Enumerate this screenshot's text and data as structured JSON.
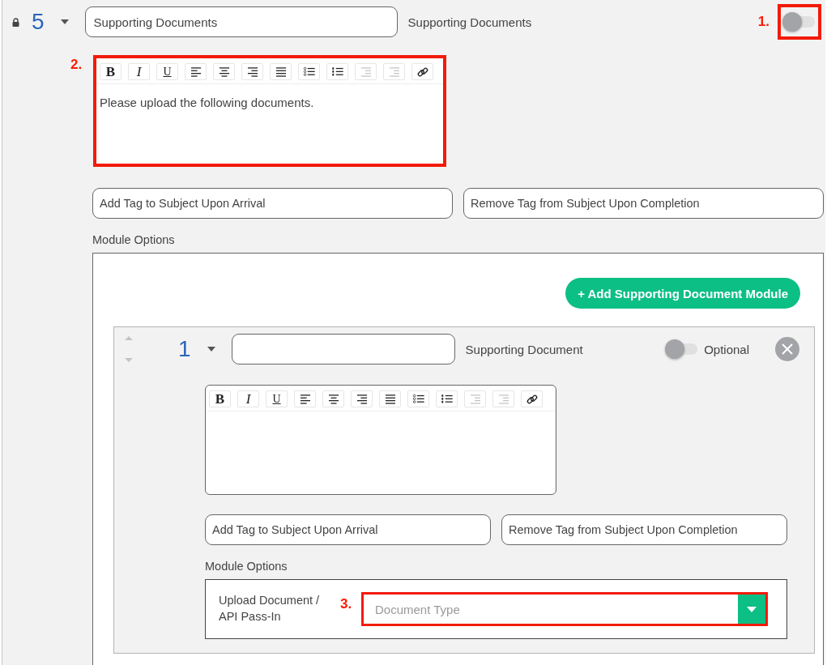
{
  "section": {
    "number": "5",
    "title_value": "Supporting Documents",
    "type_label": "Supporting Documents",
    "enabled": false,
    "toggle_callout": "1.",
    "editor": {
      "callout": "2.",
      "content": "Please upload the following documents.",
      "toolbar": [
        {
          "kind": "bold",
          "label": "B",
          "disabled": false
        },
        {
          "kind": "italic",
          "label": "I",
          "disabled": false
        },
        {
          "kind": "underline",
          "label": "U",
          "disabled": false
        },
        {
          "kind": "align-left",
          "disabled": false
        },
        {
          "kind": "align-center",
          "disabled": false
        },
        {
          "kind": "align-right",
          "disabled": false
        },
        {
          "kind": "justify",
          "disabled": false
        },
        {
          "kind": "bullet-list",
          "disabled": false
        },
        {
          "kind": "numbered-list",
          "disabled": false
        },
        {
          "kind": "indent",
          "disabled": true
        },
        {
          "kind": "outdent",
          "disabled": true
        },
        {
          "kind": "link",
          "disabled": false
        }
      ]
    },
    "tag_fields": [
      {
        "placeholder": "Add Tag to Subject Upon Arrival"
      },
      {
        "placeholder": "Remove Tag from Subject Upon Completion"
      }
    ],
    "options_label": "Module Options",
    "add_button": "+ Add Supporting Document Module",
    "module": {
      "number": "1",
      "type_label": "Supporting Document",
      "optional": false,
      "optional_label": "Optional",
      "editor": {
        "toolbar": [
          {
            "kind": "bold",
            "label": "B",
            "disabled": false
          },
          {
            "kind": "italic",
            "label": "I",
            "disabled": false
          },
          {
            "kind": "underline",
            "label": "U",
            "disabled": false
          },
          {
            "kind": "align-left",
            "disabled": false
          },
          {
            "kind": "align-center",
            "disabled": false
          },
          {
            "kind": "align-right",
            "disabled": false
          },
          {
            "kind": "justify",
            "disabled": false
          },
          {
            "kind": "bullet-list",
            "disabled": false
          },
          {
            "kind": "numbered-list",
            "disabled": false
          },
          {
            "kind": "indent",
            "disabled": true
          },
          {
            "kind": "outdent",
            "disabled": true
          },
          {
            "kind": "link",
            "disabled": false
          }
        ]
      },
      "tag_fields": [
        {
          "placeholder": "Add Tag to Subject Upon Arrival"
        },
        {
          "placeholder": "Remove Tag from Subject Upon Completion"
        }
      ],
      "options_label": "Module Options",
      "upload_label": "Upload Document / API Pass-In",
      "select": {
        "callout": "3.",
        "placeholder": "Document Type"
      }
    }
  }
}
